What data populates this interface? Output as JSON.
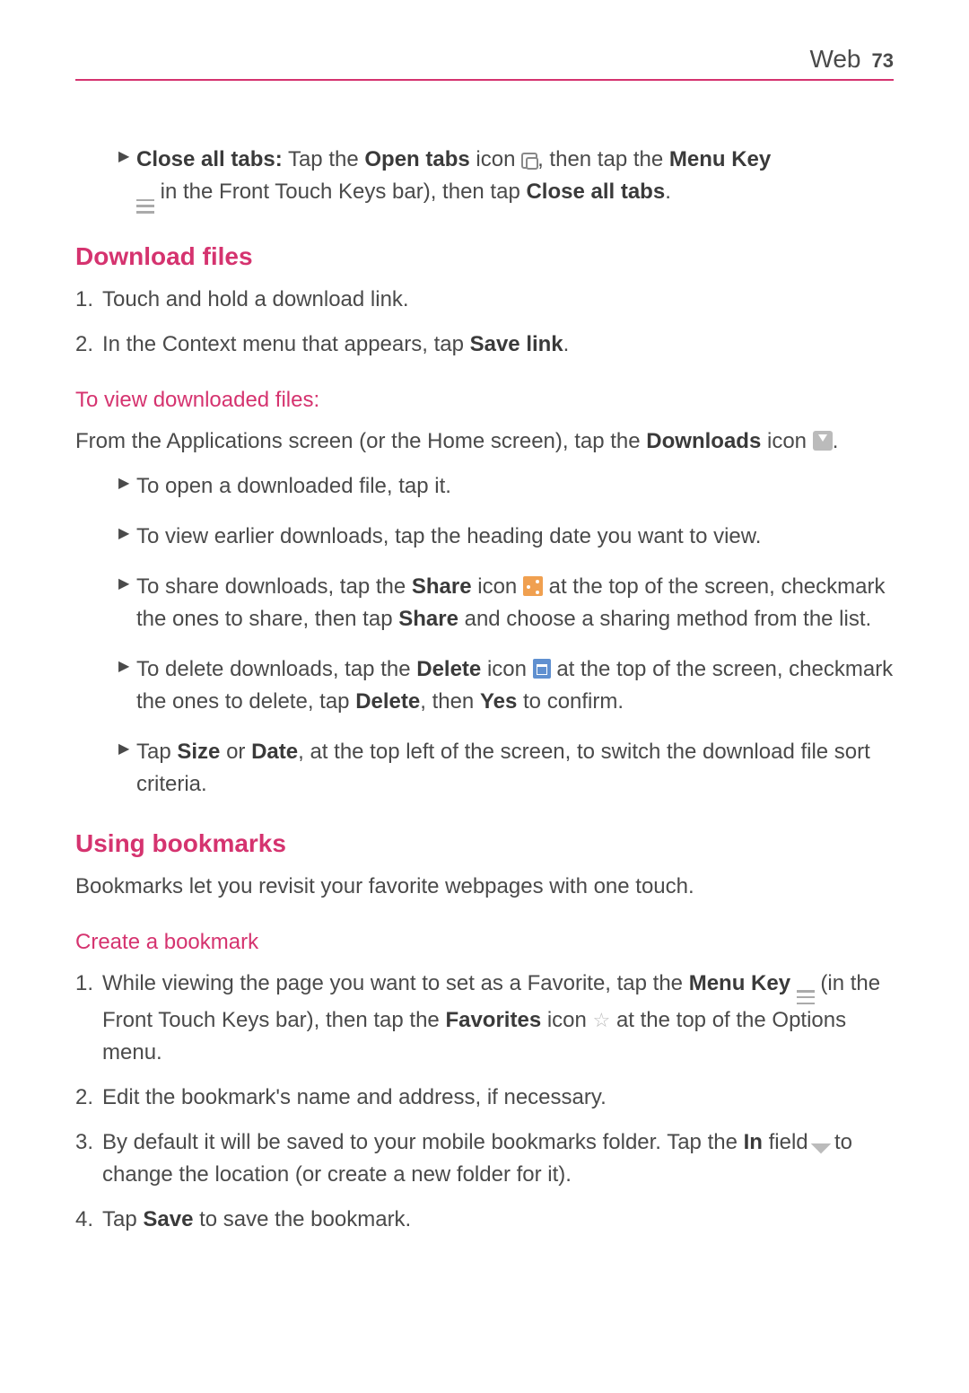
{
  "header": {
    "section": "Web",
    "page": "73"
  },
  "closeTabs": {
    "label": "Close all tabs:",
    "pre": " Tap the ",
    "openTabs": "Open tabs",
    "mid1": " icon ",
    "mid2": ", then tap the ",
    "menuKey": "Menu Key",
    "line2a": " in the Front Touch Keys bar), then tap ",
    "closeAll": "Close all tabs",
    "period": "."
  },
  "download": {
    "heading": "Download files",
    "step1": "Touch and hold a download link.",
    "step2a": "In the Context menu that appears, tap ",
    "step2b": "Save link",
    "period": "."
  },
  "viewDl": {
    "heading": "To view downloaded files:",
    "introA": "From the Applications screen (or the Home screen), tap the ",
    "introB": "Downloads",
    "introC": " icon ",
    "period": ".",
    "b1": "To open a downloaded file, tap it.",
    "b2": "To view earlier downloads, tap the heading date you want to view.",
    "b3a": "To share downloads, tap the ",
    "b3Share": "Share",
    "b3b": " icon ",
    "b3c": " at the top of the screen, checkmark the ones to share, then tap ",
    "b3d": " and choose a sharing method from the list.",
    "b4a": "To delete downloads, tap the ",
    "b4Del": "Delete",
    "b4b": " icon ",
    "b4c": " at the top of the screen, checkmark the ones to delete, tap ",
    "b4d": ", then ",
    "b4Yes": "Yes",
    "b4e": " to confirm.",
    "b5a": "Tap ",
    "b5Size": "Size",
    "b5or": " or ",
    "b5Date": "Date",
    "b5b": ", at the top left of the screen, to switch the download file sort criteria."
  },
  "bookmarks": {
    "heading": "Using bookmarks",
    "intro": "Bookmarks let you revisit your favorite webpages with one touch.",
    "createHeading": "Create a bookmark",
    "s1a": "While viewing the page you want to set as a Favorite, tap the ",
    "s1MenuKey": "Menu Key",
    "s1b": " (in the Front Touch Keys bar), then tap the ",
    "s1Fav": "Favorites",
    "s1c": " icon ",
    "s1d": " at the top of the Options menu.",
    "s2": "Edit the bookmark's name and address, if necessary.",
    "s3a": "By default it will be saved to your mobile bookmarks folder. Tap the ",
    "s3In": "In",
    "s3b": " field ",
    "s3c": " to change the location (or create a new folder for it).",
    "s4a": "Tap ",
    "s4Save": "Save",
    "s4b": " to save the bookmark."
  },
  "nums": {
    "n1": "1.",
    "n2": "2.",
    "n3": "3.",
    "n4": "4."
  },
  "marker": "▶"
}
